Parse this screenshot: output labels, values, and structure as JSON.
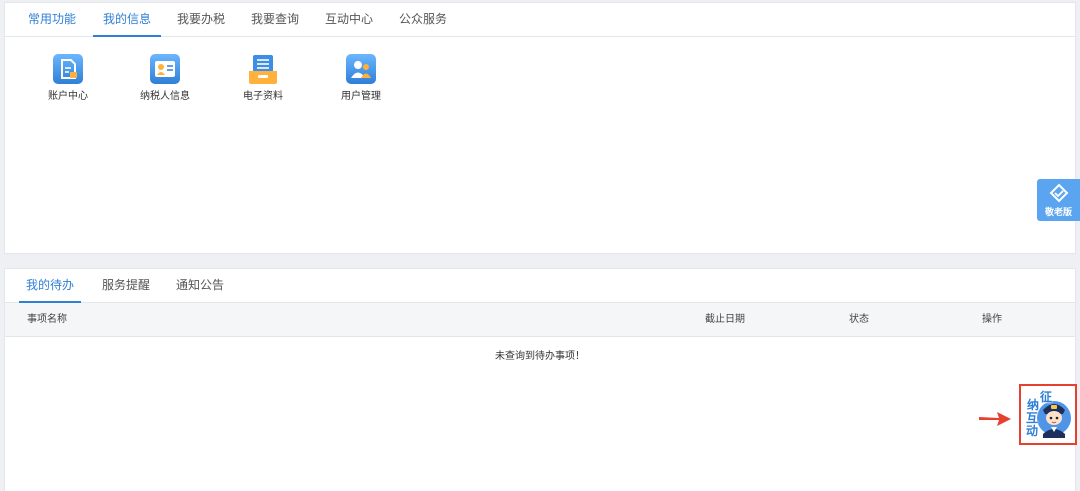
{
  "top_tabs": [
    {
      "label": "常用功能"
    },
    {
      "label": "我的信息",
      "active": true
    },
    {
      "label": "我要办税"
    },
    {
      "label": "我要查询"
    },
    {
      "label": "互动中心"
    },
    {
      "label": "公众服务"
    }
  ],
  "apps": [
    {
      "label": "账户中心",
      "icon": "account-doc-icon"
    },
    {
      "label": "纳税人信息",
      "icon": "taxpayer-card-icon"
    },
    {
      "label": "电子资料",
      "icon": "file-box-icon"
    },
    {
      "label": "用户管理",
      "icon": "users-icon"
    }
  ],
  "bottom_tabs": [
    {
      "label": "我的待办",
      "active": true
    },
    {
      "label": "服务提醒"
    },
    {
      "label": "通知公告"
    }
  ],
  "table": {
    "columns": [
      "事项名称",
      "截止日期",
      "状态",
      "操作"
    ],
    "empty_message": "未查询到待办事项！"
  },
  "elder_mode": {
    "label": "敬老版",
    "icon": "handshake-icon"
  },
  "assistant": {
    "chars": [
      "征",
      "纳",
      "互",
      "动"
    ],
    "icon": "tax-officer-avatar-icon"
  },
  "colors": {
    "accent": "#2f7fd6",
    "highlight": "#e8402f",
    "elder_bg": "#5ba5f0"
  }
}
